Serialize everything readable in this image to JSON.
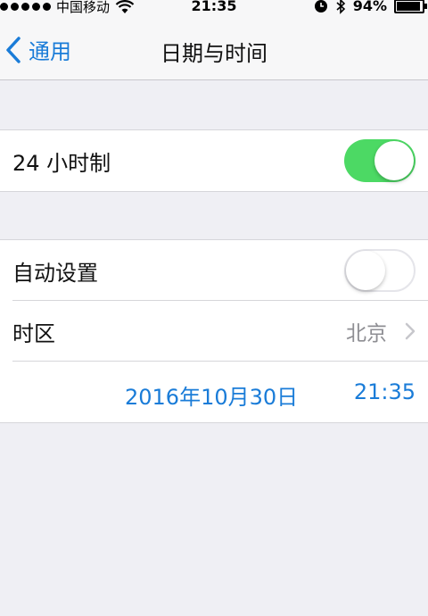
{
  "status_bar": {
    "carrier": "中国移动",
    "time": "21:35",
    "battery": "94%"
  },
  "nav": {
    "back_label": "通用",
    "title": "日期与时间"
  },
  "settings": {
    "hour24": {
      "label": "24 小时制",
      "enabled": true
    },
    "auto_set": {
      "label": "自动设置",
      "enabled": false
    },
    "timezone": {
      "label": "时区",
      "value": "北京"
    },
    "date": "2016年10月30日",
    "time": "21:35"
  },
  "colors": {
    "accent": "#1a7cd8",
    "toggle_on": "#4cd964",
    "background": "#efeff4"
  }
}
